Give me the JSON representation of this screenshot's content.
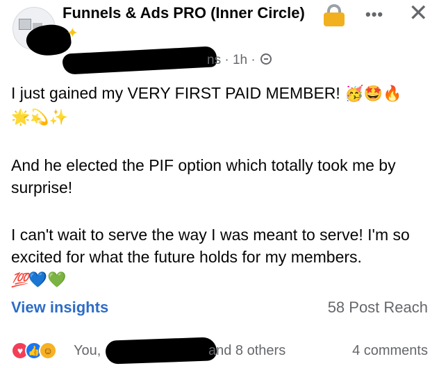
{
  "group": {
    "title": "Funnels & Ads PRO (Inner Circle)",
    "lock_icon": "lock-icon",
    "more_label": "•••",
    "close_label": "✕"
  },
  "post": {
    "meta_time": "ns · 1h ·",
    "privacy_icon": "globe-icon",
    "paragraphs": [
      "I just gained my VERY FIRST PAID MEMBER!",
      "And he elected the PIF option which totally took me by surprise!",
      "I can't wait to serve the way I was meant to serve! I'm so excited for what the future holds for my members."
    ],
    "emoji_line_1": [
      "🥳",
      "🤩",
      "🔥"
    ],
    "emoji_line_2": [
      "🌟",
      "💫",
      "✨"
    ],
    "emoji_line_3": [
      "💯",
      "💙",
      "💚"
    ]
  },
  "insights": {
    "view_label": "View insights",
    "reach_label": "58 Post Reach"
  },
  "reactions": {
    "icons": [
      "love-reaction",
      "like-reaction",
      "care-reaction"
    ],
    "prefix": "You,",
    "suffix": "and 8 others",
    "comments": "4 comments"
  },
  "colors": {
    "link_blue": "#2d6cc7",
    "secondary_text": "#65676b",
    "primary_text": "#050505"
  }
}
